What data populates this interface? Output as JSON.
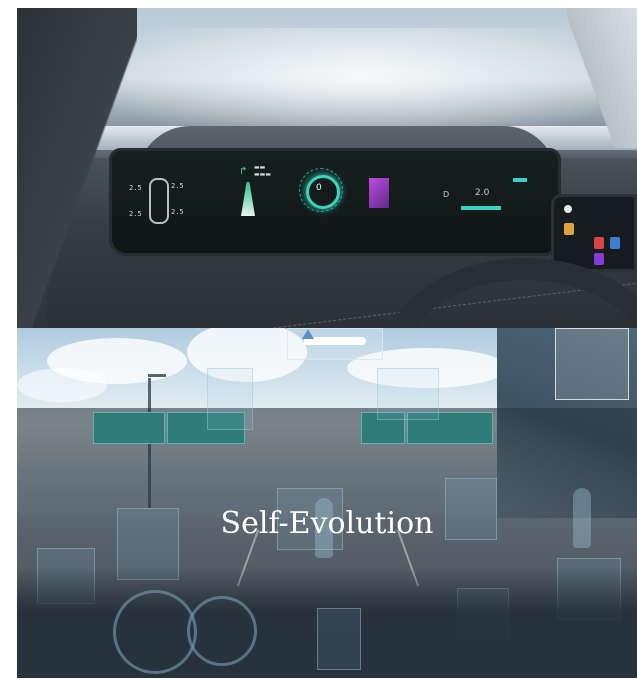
{
  "title": "Self-Evolution",
  "dashboard": {
    "tire_fl": "2.5",
    "tire_fr": "2.5",
    "tire_rl": "2.5",
    "tire_rr": "2.5",
    "speed": "0",
    "gear": "D",
    "consumption": "2.0"
  }
}
